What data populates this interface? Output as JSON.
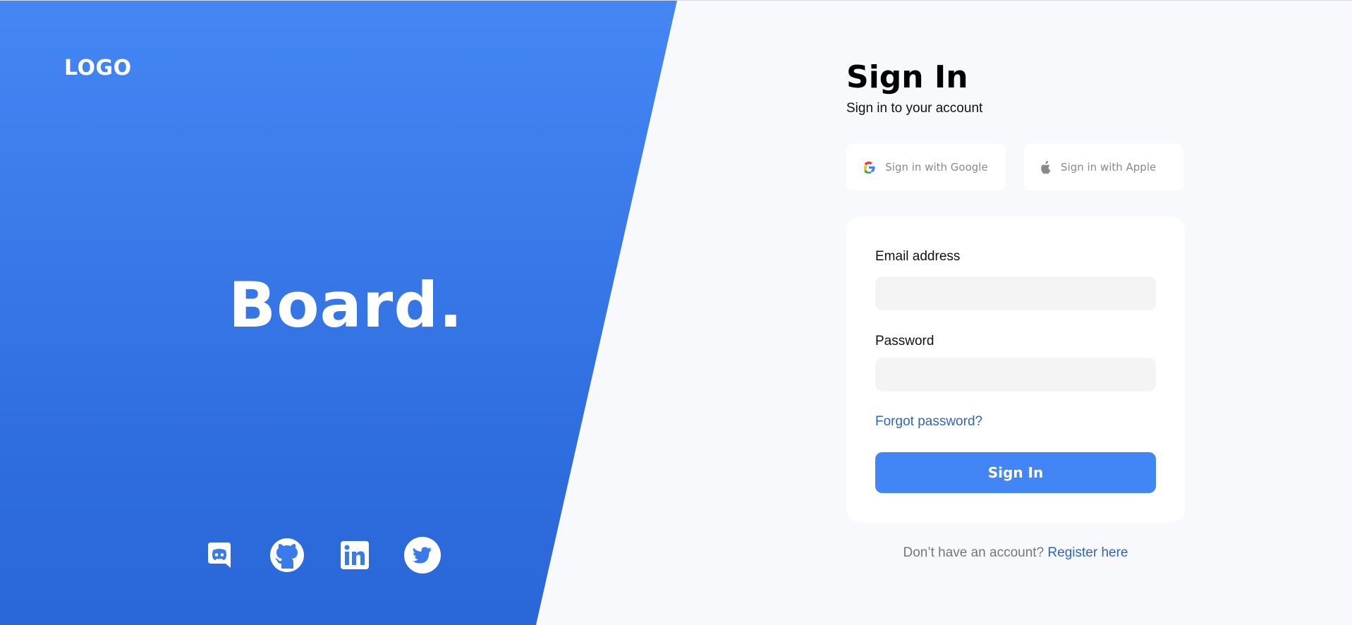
{
  "left_panel": {
    "logo": "LOGO",
    "brand": "Board.",
    "social_icons": [
      "discord-icon",
      "github-icon",
      "linkedin-icon",
      "twitter-icon"
    ]
  },
  "signin": {
    "title": "Sign In",
    "subtitle": "Sign in to your account",
    "google_label": "Sign in with Google",
    "apple_label": "Sign in with Apple",
    "email_label": "Email address",
    "email_value": "",
    "password_label": "Password",
    "password_value": "",
    "forgot_label": "Forgot password?",
    "submit_label": "Sign In",
    "register_prompt": "Don’t have an account?",
    "register_link": "Register here"
  },
  "colors": {
    "panel_blue": "#3a7ae9",
    "accent": "#4285f4",
    "link": "#2f63c7",
    "background": "#f7f9fd",
    "input_bg": "#f4f4f5"
  }
}
